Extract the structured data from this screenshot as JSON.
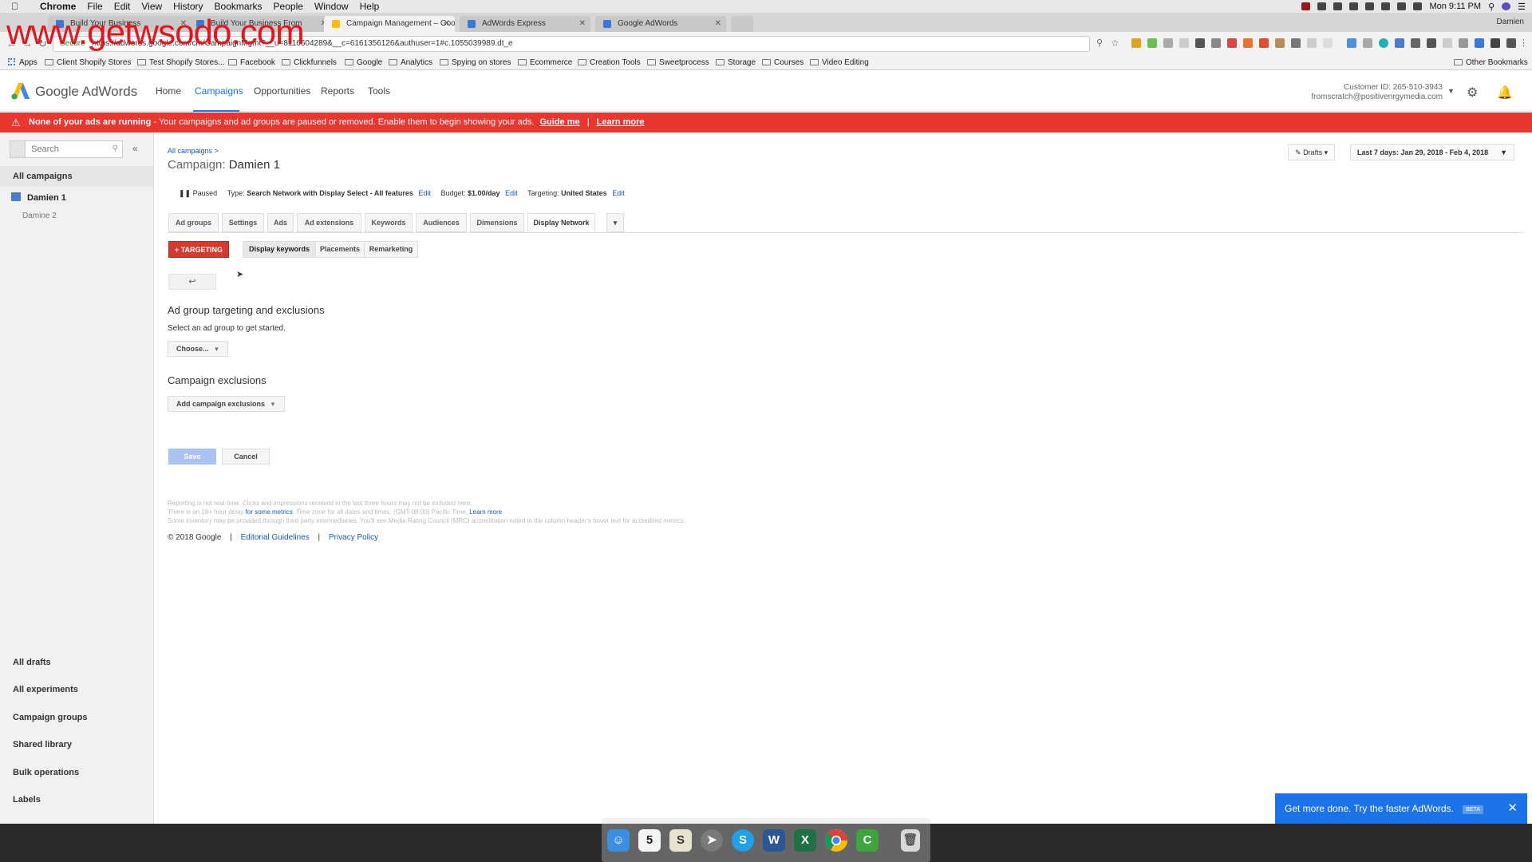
{
  "watermark": "www.getwsodo.com",
  "mac_menu": {
    "app": "Chrome",
    "items": [
      "File",
      "Edit",
      "View",
      "History",
      "Bookmarks",
      "People",
      "Window",
      "Help"
    ],
    "clock": "Mon 9:11 PM"
  },
  "browser": {
    "tabs": [
      {
        "title": "Build Your Business"
      },
      {
        "title": "Build Your Business From"
      },
      {
        "title": "Campaign Management – Goo"
      },
      {
        "title": "AdWords Express"
      },
      {
        "title": "Google AdWords"
      }
    ],
    "user": "Damien",
    "secure_label": "Secure",
    "url": "https://adwords.google.com/cm/CampaignMgmt?__u=8116604289&__c=6161356126&authuser=1#c.1055039989.dt_e"
  },
  "bookmarks": {
    "apps": "Apps",
    "items": [
      "Client Shopify Stores",
      "Test Shopify Stores...",
      "Facebook",
      "Clickfunnels",
      "Google",
      "Analytics",
      "Spying on stores",
      "Ecommerce",
      "Creation Tools",
      "Sweetprocess",
      "Storage",
      "Courses",
      "Video Editing"
    ],
    "other": "Other Bookmarks"
  },
  "adwords": {
    "brand": "Google AdWords",
    "nav": [
      "Home",
      "Campaigns",
      "Opportunities",
      "Reports",
      "Tools"
    ],
    "customer_id": "Customer ID: 265-510-3943",
    "email": "fromscratch@positivenrgymedia.com"
  },
  "alert": {
    "bold": "None of your ads are running",
    "message": " - Your campaigns and ad groups are paused or removed. Enable them to begin showing your ads.",
    "guide": "Guide me",
    "learn": "Learn more"
  },
  "sidebar": {
    "search_placeholder": "Search",
    "all_campaigns": "All campaigns",
    "campaign": "Damien 1",
    "subcampaign": "Damine 2",
    "bottom": [
      "All drafts",
      "All experiments",
      "Campaign groups",
      "Shared library",
      "Bulk operations",
      "Labels"
    ]
  },
  "main": {
    "breadcrumb": "All campaigns >",
    "title_label": "Campaign:",
    "title": "Damien 1",
    "drafts": "Drafts",
    "date_range": "Last 7 days: Jan 29, 2018 - Feb 4, 2018",
    "status": "Paused",
    "type_label": "Type:",
    "type_value": "Search Network with Display Select - All features",
    "edit": "Edit",
    "budget_label": "Budget:",
    "budget_value": "$1.00/day",
    "targeting_label": "Targeting:",
    "targeting_value": "United States",
    "tabs": [
      "Ad groups",
      "Settings",
      "Ads",
      "Ad extensions",
      "Keywords",
      "Audiences",
      "Dimensions",
      "Display Network"
    ],
    "targeting_button": "+ TARGETING",
    "subtabs": [
      "Display keywords",
      "Placements",
      "Remarketing"
    ],
    "section1_title": "Ad group targeting and exclusions",
    "section1_text": "Select an ad group to get started.",
    "choose": "Choose...",
    "section2_title": "Campaign exclusions",
    "add_exclusions": "Add campaign exclusions",
    "save": "Save",
    "cancel": "Cancel",
    "fine1": "Reporting is not real-time. Clicks and impressions received in the last three hours may not be included here.",
    "fine2a": "There is an 18+ hour delay",
    "fine2b": "for some metrics",
    "fine2c": ". Time zone for all dates and times: (GMT-08:00) Pacific Time.",
    "fine2d": "Learn more",
    "fine3": "Some inventory may be provided through third party intermediaries. You'll see Media Rating Council (MRC) accreditation noted in the column header's hover text for accredited metrics.",
    "copyright": "© 2018 Google",
    "editorial": "Editorial Guidelines",
    "privacy": "Privacy Policy"
  },
  "promo": {
    "text": "Get more done. Try the faster AdWords.",
    "beta": "BETA"
  },
  "dock": {
    "calendar_day": "5"
  }
}
